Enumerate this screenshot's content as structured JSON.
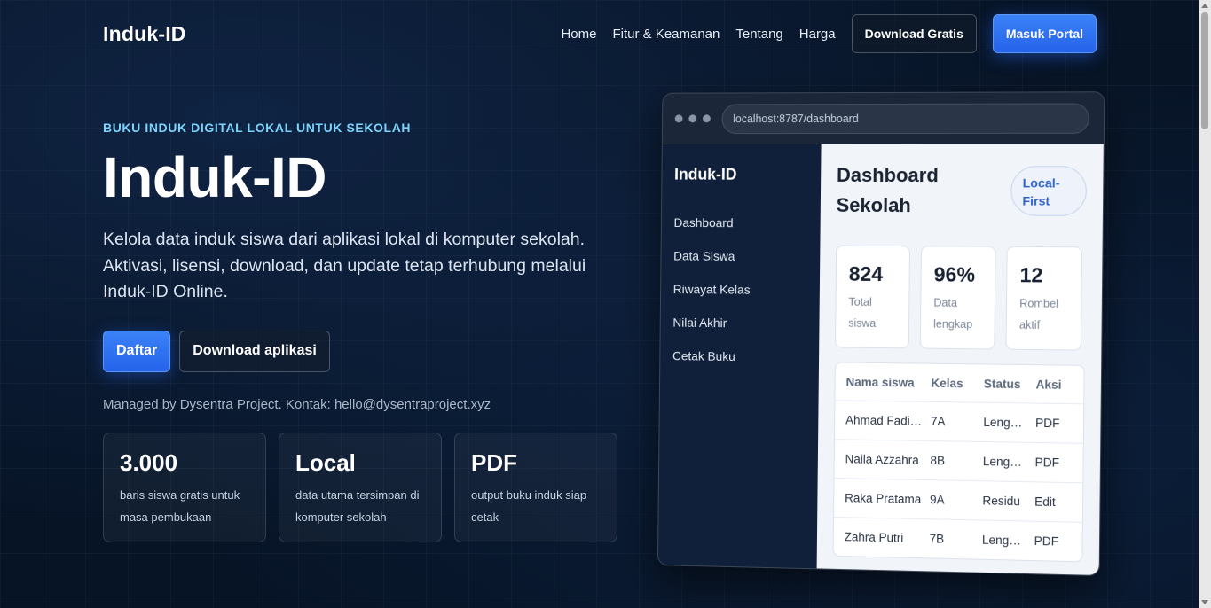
{
  "nav": {
    "brand": "Induk-ID",
    "links": [
      "Home",
      "Fitur & Keamanan",
      "Tentang",
      "Harga"
    ],
    "download_label": "Download Gratis",
    "portal_label": "Masuk Portal"
  },
  "hero": {
    "eyebrow": "BUKU INDUK DIGITAL LOKAL UNTUK SEKOLAH",
    "title": "Induk-ID",
    "description": "Kelola data induk siswa dari aplikasi lokal di komputer sekolah. Aktivasi, lisensi, download, dan update tetap terhubung melalui Induk-ID Online.",
    "primary_cta": "Daftar",
    "secondary_cta": "Download aplikasi",
    "managed_by": "Managed by Dysentra Project. Kontak: hello@dysentraproject.xyz"
  },
  "stats": [
    {
      "value": "3.000",
      "desc": "baris siswa gratis untuk masa pembukaan"
    },
    {
      "value": "Local",
      "desc": "data utama tersimpan di komputer sekolah"
    },
    {
      "value": "PDF",
      "desc": "output buku induk siap cetak"
    }
  ],
  "mockup": {
    "url": "localhost:8787/dashboard",
    "sidebar_brand": "Induk-ID",
    "sidebar_items": [
      "Dashboard",
      "Data Siswa",
      "Riwayat Kelas",
      "Nilai Akhir",
      "Cetak Buku"
    ],
    "title": "Dashboard Sekolah",
    "badge": "Local-First",
    "mini_stats": [
      {
        "value": "824",
        "label": "Total siswa"
      },
      {
        "value": "96%",
        "label": "Data lengkap"
      },
      {
        "value": "12",
        "label": "Rombel aktif"
      }
    ],
    "table": {
      "headers": [
        "Nama siswa",
        "Kelas",
        "Status",
        "Aksi"
      ],
      "rows": [
        [
          "Ahmad Fadi…",
          "7A",
          "Leng…",
          "PDF"
        ],
        [
          "Naila Azzahra",
          "8B",
          "Leng…",
          "PDF"
        ],
        [
          "Raka Pratama",
          "9A",
          "Residu",
          "Edit"
        ],
        [
          "Zahra Putri",
          "7B",
          "Leng…",
          "PDF"
        ]
      ]
    }
  },
  "colors": {
    "accent": "#2563eb",
    "eyebrow": "#7dd3fc",
    "background": "#071426"
  }
}
